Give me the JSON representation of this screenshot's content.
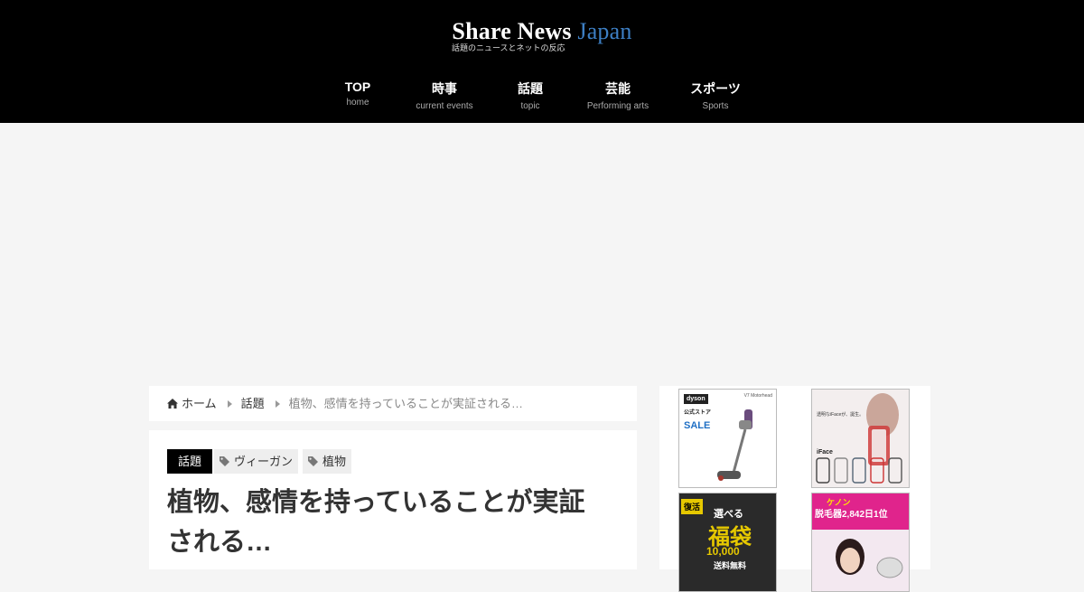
{
  "header": {
    "logo_main": "Share News ",
    "logo_accent": "Japan",
    "tagline": "話題のニュースとネットの反応"
  },
  "nav": [
    {
      "label": "TOP",
      "sub": "home"
    },
    {
      "label": "時事",
      "sub": "current events"
    },
    {
      "label": "話題",
      "sub": "topic"
    },
    {
      "label": "芸能",
      "sub": "Performing arts"
    },
    {
      "label": "スポーツ",
      "sub": "Sports"
    }
  ],
  "breadcrumb": {
    "home": "ホーム",
    "category": "話題",
    "current": "植物、感情を持っていることが実証される…"
  },
  "article": {
    "category": "話題",
    "tags": [
      "ヴィーガン",
      "植物"
    ],
    "title": "植物、感情を持っていることが実証される…"
  },
  "sidebar": {
    "banners": [
      {
        "brand": "dyson",
        "line1": "公式ストア",
        "line2": "SALE",
        "model": "V7 Motorhead"
      },
      {
        "line1": "透明なiFaceが、誕生。",
        "brand": "iFace"
      },
      {
        "line1": "復活",
        "line2": "選べる",
        "line3": "福袋",
        "line4": "10,000",
        "line5": "送料無料"
      },
      {
        "line1": "ケノン",
        "line2": "脱毛器2,842日1位"
      }
    ]
  },
  "colors": {
    "header_bg": "#000000",
    "accent": "#3d7fc4",
    "page_bg": "#f5f5f5"
  }
}
